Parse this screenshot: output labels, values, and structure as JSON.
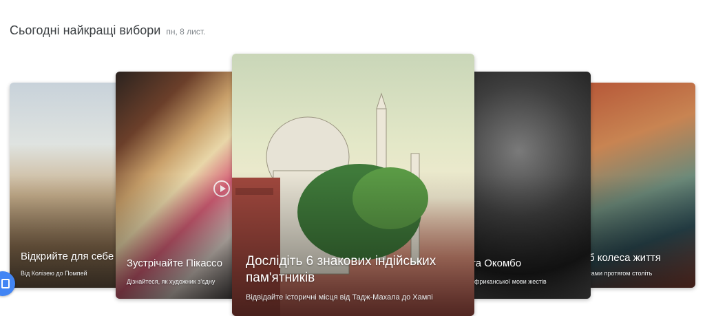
{
  "header": {
    "title": "Сьогодні найкращі вибори",
    "date": "пн, 8 лист."
  },
  "cards": [
    {
      "title": "Відкрийте для себе",
      "subtitle": "Від Колізею до Помпей"
    },
    {
      "title": "Зустрічайте Пікассо",
      "subtitle": "Дізнайтеся, як художник з'єдну",
      "icon": "play-icon"
    },
    {
      "title": "Дослідіть 6 знакових індійських пам'ятників",
      "subtitle": "Відвідайте історичні місця від Тадж-Махала до Хампі"
    },
    {
      "title": "та Окомбо",
      "subtitle": "африканської мови жестів"
    },
    {
      "title": "таб колеса життя",
      "subtitle": "дистами протягом століть"
    }
  ],
  "fab": {
    "icon": "card-icon",
    "color": "#4285f4"
  }
}
